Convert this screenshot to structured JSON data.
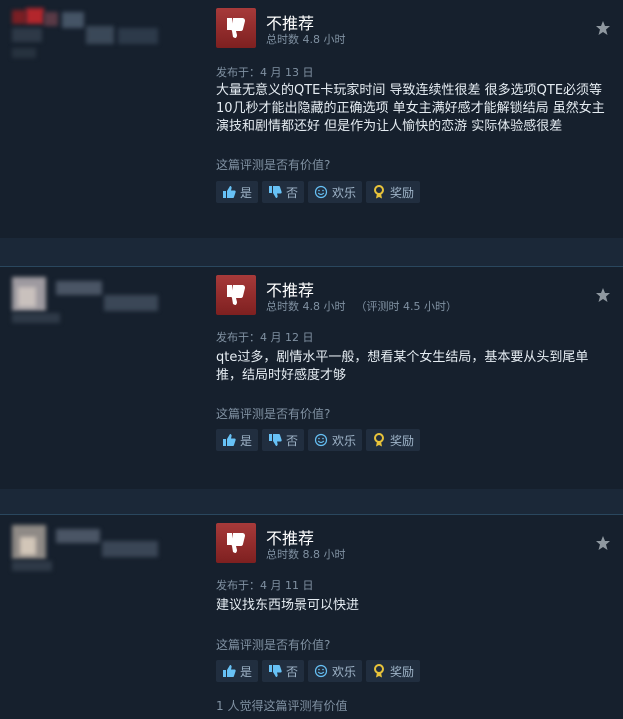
{
  "helpful_question": "这篇评测是否有价值?",
  "buttons": {
    "yes": "是",
    "no": "否",
    "funny": "欢乐",
    "award": "奖励"
  },
  "colors": {
    "thumb_red": "#a73a3a",
    "bg": "#1b2838",
    "card": "#16202d"
  },
  "reviews": [
    {
      "verdict": "不推荐",
      "hours": "总时数 4.8 小时",
      "hours_extra": "",
      "posted": "发布于：4 月 13 日",
      "text": "大量无意义的QTE卡玩家时间 导致连续性很差 很多选项QTE必须等10几秒才能出隐藏的正确选项 单女主满好感才能解锁结局 虽然女主演技和剧情都还好 但是作为让人愉快的恋游 实际体验感很差",
      "found_helpful": ""
    },
    {
      "verdict": "不推荐",
      "hours": "总时数 4.8 小时",
      "hours_extra": "（评测时 4.5 小时）",
      "posted": "发布于：4 月 12 日",
      "text": "qte过多，剧情水平一般，想看某个女生结局，基本要从头到尾单推，结局时好感度才够",
      "found_helpful": ""
    },
    {
      "verdict": "不推荐",
      "hours": "总时数 8.8 小时",
      "hours_extra": "",
      "posted": "发布于：4 月 11 日",
      "text": "建议找东西场景可以快进",
      "found_helpful": "1 人觉得这篇评测有价值"
    }
  ]
}
